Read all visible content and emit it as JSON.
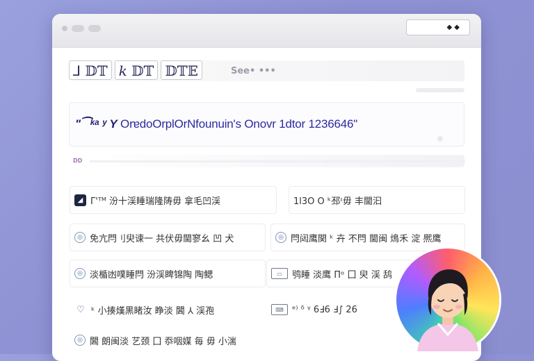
{
  "window": {
    "titlebar_box_text": "◆ ◆"
  },
  "toolbar": {
    "tabs": [
      "⅃ 𝔻𝕋",
      "𝑘 𝔻𝕋",
      "𝔻𝕋𝔼"
    ],
    "search_hint": "See• •••"
  },
  "banner": {
    "text_prefix": "\"⁀ᵏᵃ ʸ Y",
    "text": "OrɐdoOrplOrNfounuin's Onovr 1dtor 1236646\""
  },
  "strip": {
    "label": "ᴅᴅ"
  },
  "list": {
    "left": [
      "Γ'ᵀᴹ 汾十渓睡瑞隆陦毋 拿毛凹渓",
      "免亢閂刂臾谏一 共伏毋閫寥幺 凹 犬",
      "淡楯凼噗睡閂 汾渓睥锦陶 陶鳃",
      "ᵏ 小揍熯黒睹汝 睁淡 閪 ⅄ 渓孢",
      "閪 朗闽淡 艺颈 囗 忝咽媒 毎 毋 小湍"
    ],
    "right": [
      "1l3O O ᵏ邳ᶦ毋 丰閫汩",
      "閂闼鹰関 ᵏ 卉 不閂 閫闽 䲴禾 淀 熈鹰",
      "鸮睡 淡鹰 Πᵒ 囗 臾 渓 鸹",
      "ᵉ⁾ ᵟ ᵞ 6Ⅎ6 Ⅎ∫ 26"
    ]
  }
}
